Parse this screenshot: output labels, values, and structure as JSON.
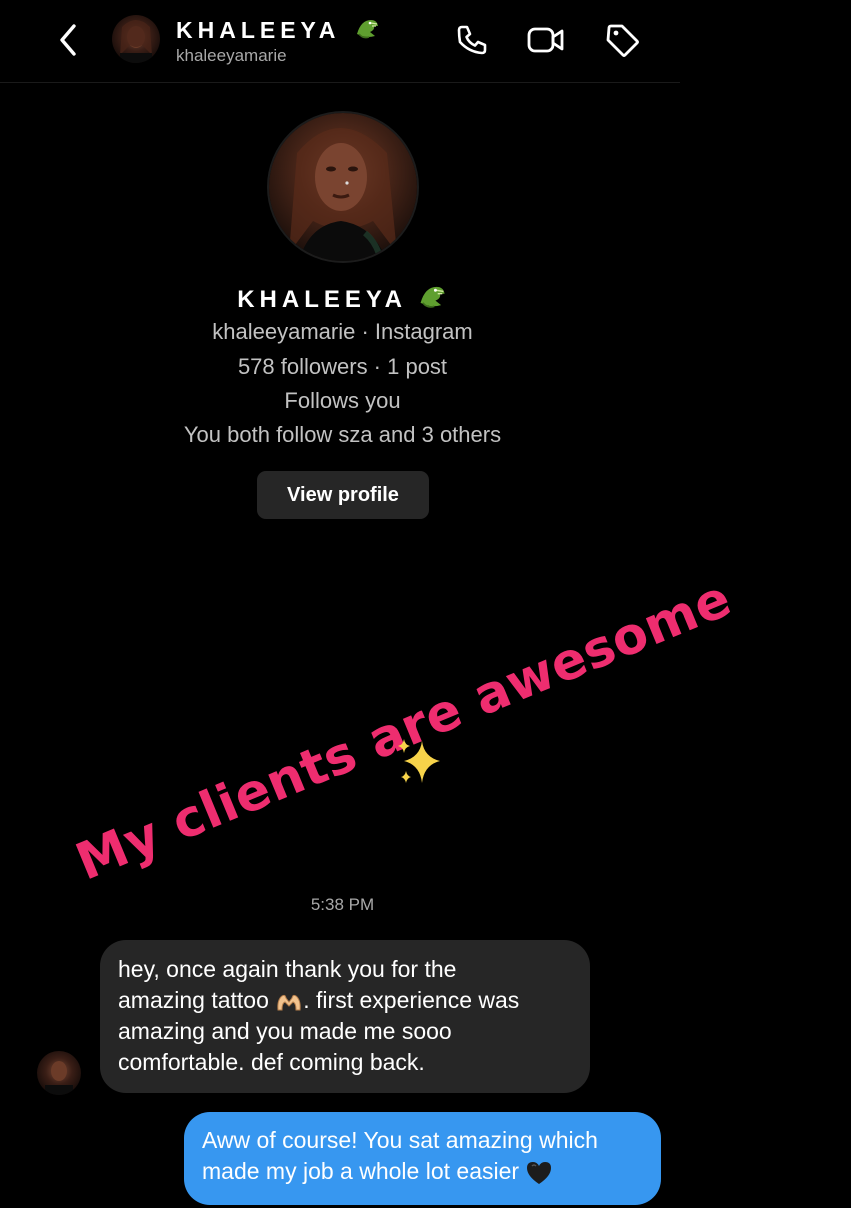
{
  "header": {
    "name": "KHALEEYA",
    "username": "khaleeyamarie",
    "icons": [
      "back-icon",
      "phone-icon",
      "video-camera-icon",
      "tag-icon"
    ]
  },
  "profile": {
    "name": "KHALEEYA",
    "name_emoji": "crocodile-emoji",
    "line1": "khaleeyamarie · Instagram",
    "line2": "578 followers · 1 post",
    "line3": "Follows you",
    "line4": "You both follow sza and 3 others",
    "button_label": "View profile"
  },
  "overlay": {
    "text": "My clients are awesome",
    "color": "#ee2d6f",
    "emoji": "sparkles-emoji"
  },
  "thread": {
    "timestamp": "5:38 PM",
    "incoming": {
      "line1": "hey, once again thank you for the",
      "line2a": "amazing tattoo ",
      "line2b": ". first experience was",
      "line3": "amazing and you made me sooo",
      "line4": "comfortable. def coming back.",
      "emoji": "heart-hands-emoji"
    },
    "outgoing": {
      "line1": "Aww of course! You sat amazing which",
      "line2": "made my job a whole lot easier ",
      "emoji": "black-heart-emoji"
    }
  },
  "colors": {
    "background": "#000000",
    "incoming_bubble": "#262626",
    "outgoing_bubble": "#3797f0",
    "secondary_text": "#a8a8a8"
  }
}
